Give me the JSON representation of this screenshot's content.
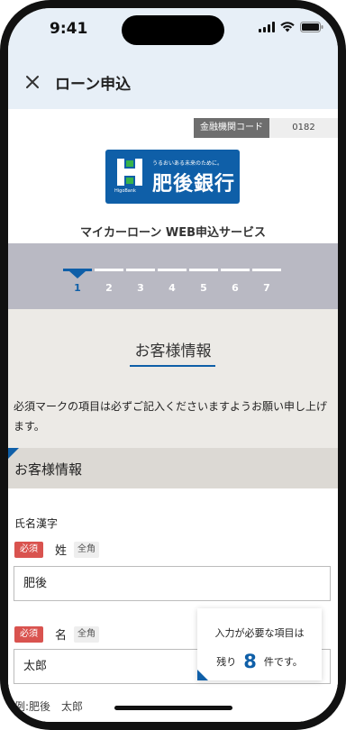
{
  "status_bar": {
    "time": "9:41"
  },
  "header": {
    "title": "ローン申込",
    "close_icon": "close-icon"
  },
  "fi_code": {
    "label": "金融機関コード",
    "value": "0182"
  },
  "logo": {
    "tagline": "うるおいある未来のために。",
    "name": "肥後銀行",
    "subname": "HigoBank"
  },
  "service_name": "マイカーローン WEB申込サービス",
  "steps": {
    "items": [
      "1",
      "2",
      "3",
      "4",
      "5",
      "6",
      "7"
    ],
    "current": 1
  },
  "section": {
    "title": "お客様情報"
  },
  "notice": "必須マークの項目は必ずご記入くださいますようお願い申し上げます。",
  "sub_header": "お客様情報",
  "name_group": {
    "label": "氏名漢字",
    "last_name": {
      "required": "必須",
      "label": "姓",
      "width": "全角",
      "value": "肥後"
    },
    "first_name": {
      "required": "必須",
      "label": "名",
      "width": "全角",
      "value": "太郎"
    },
    "example": "例:肥後　太郎"
  },
  "remaining": {
    "line1": "入力が必要な項目は",
    "prefix": "残り",
    "count": "8",
    "suffix": "件です。"
  },
  "colors": {
    "accent": "#0f5fa8",
    "required": "#d9534f",
    "header_bg": "#e7eff7",
    "stepper_bg": "#b9b9c3"
  }
}
